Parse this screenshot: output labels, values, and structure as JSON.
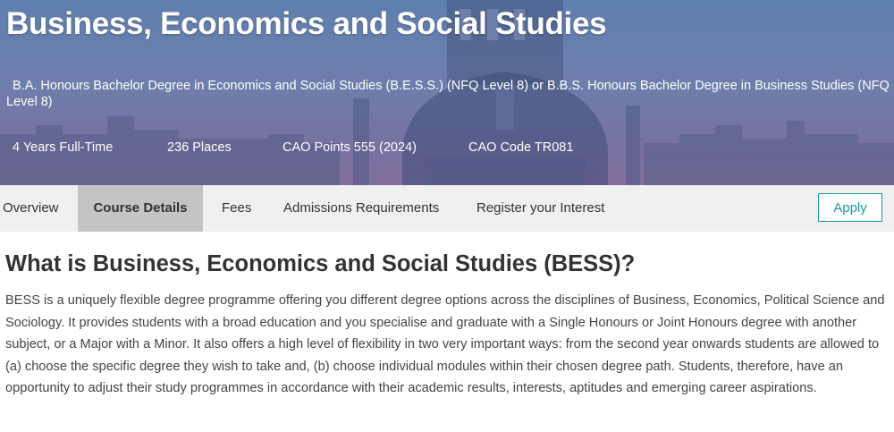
{
  "hero": {
    "title": "Business, Economics and Social Studies",
    "subtitle": "B.A. Honours Bachelor Degree in Economics and Social Studies (B.E.S.S.) (NFQ Level 8) or B.B.S. Honours Bachelor Degree in Business Studies (NFQ Level 8)",
    "facts": {
      "duration": "4 Years Full-Time",
      "places": "236 Places",
      "cao_points": "CAO Points 555 (2024)",
      "cao_code": "CAO Code TR081"
    }
  },
  "tabs": {
    "overview": "Overview",
    "course_details": "Course Details",
    "fees": "Fees",
    "admissions": "Admissions Requirements",
    "register": "Register your Interest",
    "active": "Course Details"
  },
  "apply_label": "Apply",
  "section": {
    "heading": "What is Business, Economics and Social Studies (BESS)?",
    "body": "BESS is a uniquely flexible degree programme offering you different degree options across the disciplines of Business, Economics, Political Science and Sociology. It provides students with a broad education and you specialise and graduate with a Single Honours or Joint Honours degree with another subject, or a Major with a Minor. It also offers a high level of flexibility in two very important ways: from the second year onwards students are allowed to (a) choose the specific degree they wish to take and, (b) choose individual modules within their chosen degree path. Students, therefore, have an opportunity to adjust their study programmes in accordance with their academic results, interests, aptitudes and emerging career aspirations."
  },
  "colors": {
    "accent": "#1a9aa1",
    "active_tab": "#c4c4c4",
    "tabbar_bg": "#f0f0f0"
  }
}
